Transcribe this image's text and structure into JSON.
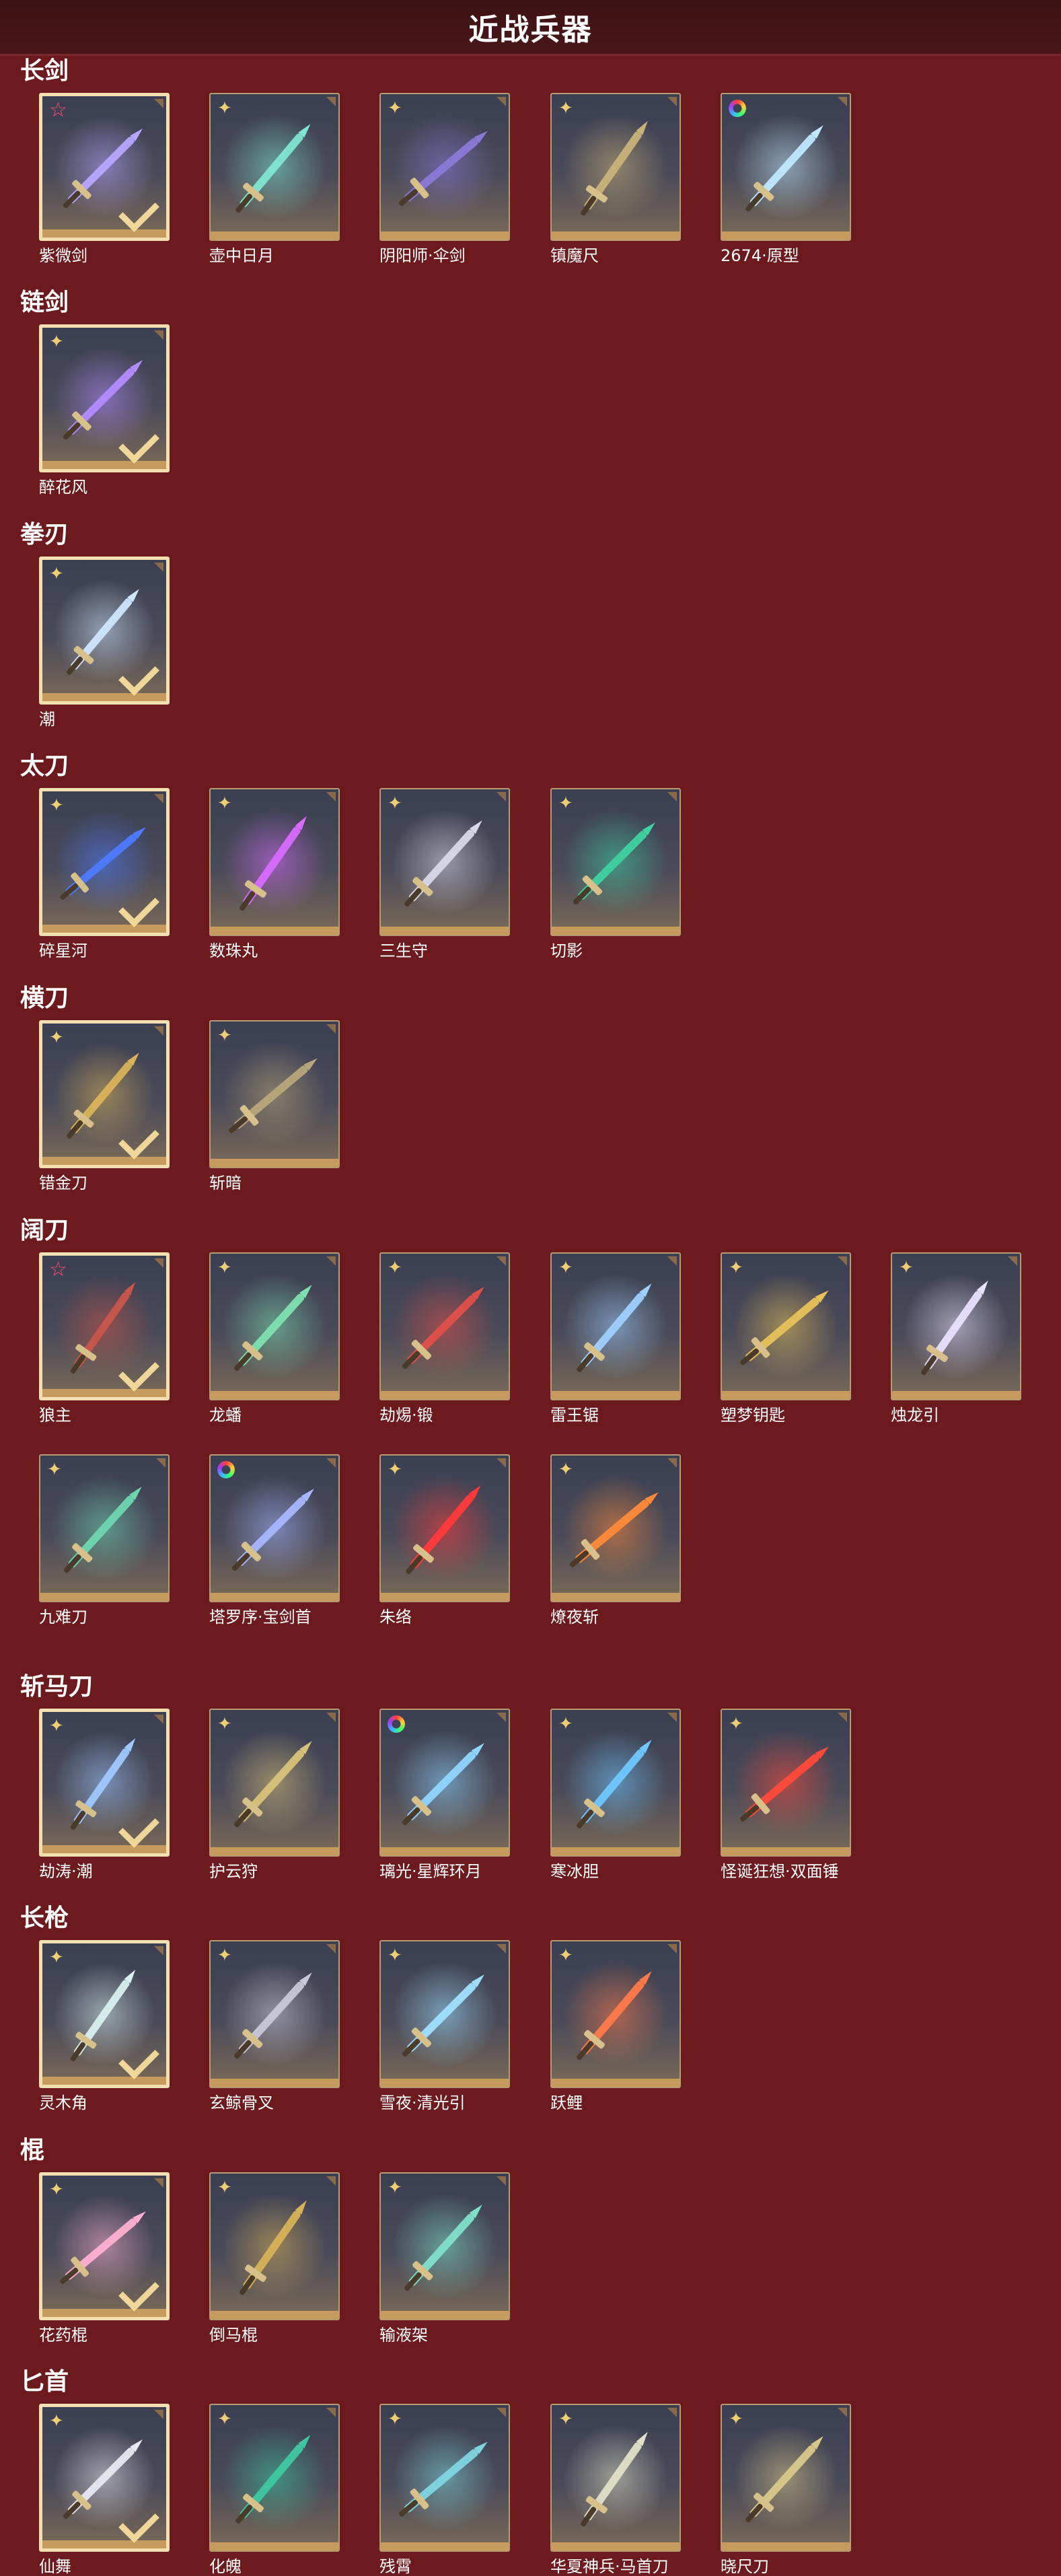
{
  "header": {
    "title": "近战兵器"
  },
  "sections": [
    {
      "title": "长剑",
      "items": [
        {
          "name": "紫微剑",
          "badge": "star",
          "owned": true,
          "color": "#b7a6ff"
        },
        {
          "name": "壶中日月",
          "badge": "flower",
          "owned": false,
          "color": "#7fe6d0"
        },
        {
          "name": "阴阳师·伞剑",
          "badge": "flower",
          "owned": false,
          "color": "#8a79d8"
        },
        {
          "name": "镇魔尺",
          "badge": "flower",
          "owned": false,
          "color": "#c9b27a"
        },
        {
          "name": "2674·原型",
          "badge": "ring",
          "owned": false,
          "color": "#bfe8ff"
        }
      ]
    },
    {
      "title": "链剑",
      "items": [
        {
          "name": "醉花风",
          "badge": "flower",
          "owned": true,
          "color": "#b38cff"
        }
      ]
    },
    {
      "title": "拳刃",
      "items": [
        {
          "name": "潮",
          "badge": "flower",
          "owned": true,
          "color": "#cfe6ff"
        }
      ]
    },
    {
      "title": "太刀",
      "items": [
        {
          "name": "碎星河",
          "badge": "flower",
          "owned": true,
          "color": "#4d7bff"
        },
        {
          "name": "数珠丸",
          "badge": "flower",
          "owned": false,
          "color": "#d86cff"
        },
        {
          "name": "三生守",
          "badge": "flower",
          "owned": false,
          "color": "#d8d8e8"
        },
        {
          "name": "切影",
          "badge": "flower",
          "owned": false,
          "color": "#3fd1a0"
        }
      ]
    },
    {
      "title": "横刀",
      "items": [
        {
          "name": "错金刀",
          "badge": "flower",
          "owned": true,
          "color": "#d9b35a"
        },
        {
          "name": "斩暗",
          "badge": "flower",
          "owned": false,
          "color": "#b8a67a"
        }
      ]
    },
    {
      "title": "阔刀",
      "items": [
        {
          "name": "狼主",
          "badge": "star",
          "owned": true,
          "color": "#c8554a"
        },
        {
          "name": "龙蟠",
          "badge": "flower",
          "owned": false,
          "color": "#7ee0b0"
        },
        {
          "name": "劫焬·锻",
          "badge": "flower",
          "owned": false,
          "color": "#e0504a"
        },
        {
          "name": "雷王锯",
          "badge": "flower",
          "owned": false,
          "color": "#9fd0ff"
        },
        {
          "name": "塑梦钥匙",
          "badge": "flower",
          "owned": false,
          "color": "#e8c15a"
        },
        {
          "name": "烛龙引",
          "badge": "flower",
          "owned": false,
          "color": "#e8e0ff"
        },
        {
          "name": "九难刀",
          "badge": "flower",
          "owned": false,
          "color": "#6fd6b0"
        },
        {
          "name": "塔罗序·宝剑首",
          "badge": "ring",
          "owned": false,
          "color": "#a6b6ff"
        },
        {
          "name": "朱络",
          "badge": "flower",
          "owned": false,
          "color": "#ff3a3a"
        },
        {
          "name": "燎夜斩",
          "badge": "flower",
          "owned": false,
          "color": "#ff8a3a"
        }
      ]
    },
    {
      "title": "斩马刀",
      "items": [
        {
          "name": "劫涛·潮",
          "badge": "flower",
          "owned": true,
          "color": "#9fc8ff"
        },
        {
          "name": "护云狩",
          "badge": "flower",
          "owned": false,
          "color": "#d8c27a"
        },
        {
          "name": "璃光·星辉环月",
          "badge": "ring",
          "owned": false,
          "color": "#8fd6ff"
        },
        {
          "name": "寒冰胆",
          "badge": "flower",
          "owned": false,
          "color": "#6fc8ff"
        },
        {
          "name": "怪诞狂想·双面锤",
          "badge": "flower",
          "owned": false,
          "color": "#ff4a3a"
        }
      ]
    },
    {
      "title": "长枪",
      "items": [
        {
          "name": "灵木角",
          "badge": "flower",
          "owned": true,
          "color": "#d8f0ee"
        },
        {
          "name": "玄鲸骨叉",
          "badge": "flower",
          "owned": false,
          "color": "#c8c8d8"
        },
        {
          "name": "雪夜·清光引",
          "badge": "flower",
          "owned": false,
          "color": "#9fe0ff"
        },
        {
          "name": "跃鲤",
          "badge": "flower",
          "owned": false,
          "color": "#ff7a4a"
        }
      ]
    },
    {
      "title": "棍",
      "items": [
        {
          "name": "花药棍",
          "badge": "flower",
          "owned": true,
          "color": "#ffb0d0"
        },
        {
          "name": "倒马棍",
          "badge": "flower",
          "owned": false,
          "color": "#d8b25a"
        },
        {
          "name": "输液架",
          "badge": "flower",
          "owned": false,
          "color": "#7fe0c8"
        }
      ]
    },
    {
      "title": "匕首",
      "items": [
        {
          "name": "仙舞",
          "badge": "flower",
          "owned": true,
          "color": "#e8e8f0"
        },
        {
          "name": "化魄",
          "badge": "flower",
          "owned": false,
          "color": "#3fc8a0"
        },
        {
          "name": "残霄",
          "badge": "flower",
          "owned": false,
          "color": "#7fd6e0"
        },
        {
          "name": "华夏神兵·马首刀",
          "badge": "flower",
          "owned": false,
          "color": "#e0e0c8"
        },
        {
          "name": "晓尺刀",
          "badge": "flower",
          "owned": false,
          "color": "#d8c88a"
        }
      ]
    }
  ]
}
